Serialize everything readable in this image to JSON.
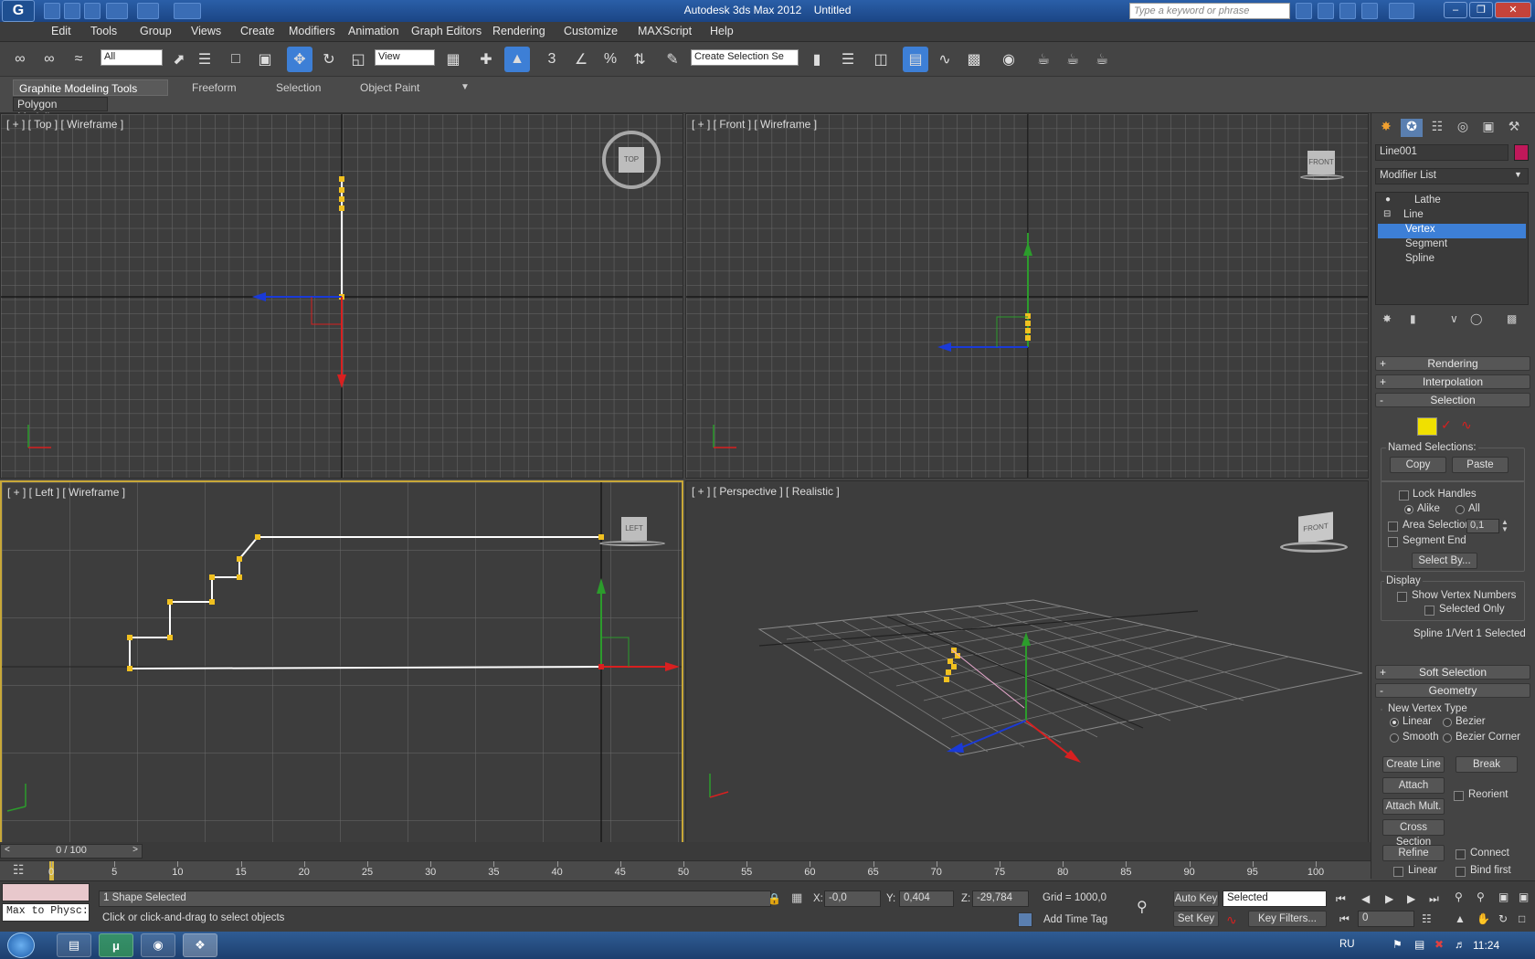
{
  "titlebar": {
    "app_title": "Autodesk 3ds Max  2012",
    "doc_title": "Untitled",
    "search_placeholder": "Type a keyword or phrase"
  },
  "menu": [
    "Edit",
    "Tools",
    "Group",
    "Views",
    "Create",
    "Modifiers",
    "Animation",
    "Graph Editors",
    "Rendering",
    "Customize",
    "MAXScript",
    "Help"
  ],
  "toolbar": {
    "filter_select": "All",
    "refcoord_select": "View",
    "named_selection_select": "Create Selection Se",
    "snap_labels": [
      "3",
      "%"
    ]
  },
  "ribbon": {
    "tabs": [
      "Graphite Modeling Tools",
      "Freeform",
      "Selection",
      "Object Paint"
    ],
    "subpanel": "Polygon Modeling"
  },
  "viewports": {
    "top": "[ + ] [ Top ] [ Wireframe ]",
    "front": "[ + ] [ Front ] [ Wireframe ]",
    "left": "[ + ] [ Left ] [ Wireframe ]",
    "perspective": "[ + ] [ Perspective ] [ Realistic ]",
    "cube_top": "TOP",
    "cube_front": "FRONT",
    "cube_left": "LEFT",
    "cube_persp": "FRONT"
  },
  "command_panel": {
    "object_name": "Line001",
    "object_color": "#c0185a",
    "modifier_list": "Modifier List",
    "stack": [
      "Lathe",
      "Line",
      "Vertex",
      "Segment",
      "Spline"
    ],
    "stack_selected": "Vertex",
    "rollouts": {
      "rendering": "Rendering",
      "interpolation": "Interpolation",
      "selection": "Selection",
      "soft_selection": "Soft Selection",
      "geometry": "Geometry"
    },
    "selection": {
      "named_selections": "Named Selections:",
      "copy": "Copy",
      "paste": "Paste",
      "lock_handles": "Lock Handles",
      "alike": "Alike",
      "all": "All",
      "area_selection": "Area Selection:",
      "area_value": "0,1",
      "segment_end": "Segment End",
      "select_by": "Select By...",
      "display": "Display",
      "show_vertex_numbers": "Show Vertex Numbers",
      "selected_only": "Selected Only",
      "status": "Spline 1/Vert 1 Selected"
    },
    "geometry": {
      "new_vertex_type": "New Vertex Type",
      "linear": "Linear",
      "bezier": "Bezier",
      "smooth": "Smooth",
      "bezier_corner": "Bezier Corner",
      "create_line": "Create Line",
      "break": "Break",
      "attach": "Attach",
      "reorient": "Reorient",
      "attach_mult": "Attach Mult.",
      "cross_section": "Cross Section",
      "refine": "Refine",
      "connect": "Connect",
      "linear2": "Linear",
      "bind_first": "Bind first"
    }
  },
  "timeline": {
    "frame_counter": "0 / 100",
    "ticks": [
      "0",
      "5",
      "10",
      "15",
      "20",
      "25",
      "30",
      "35",
      "40",
      "45",
      "50",
      "55",
      "60",
      "65",
      "70",
      "75",
      "80",
      "85",
      "90",
      "95",
      "100"
    ]
  },
  "status": {
    "maxscript_listener": "Max to Physc:",
    "selection_info": "1 Shape Selected",
    "prompt": "Click or click-and-drag to select objects",
    "x_label": "X:",
    "x_value": "-0,0",
    "y_label": "Y:",
    "y_value": "0,404",
    "z_label": "Z:",
    "z_value": "-29,784",
    "grid": "Grid = 1000,0",
    "auto_key": "Auto Key",
    "set_key": "Set Key",
    "key_mode_select": "Selected",
    "key_filters": "Key Filters...",
    "add_time_tag": "Add Time Tag",
    "current_frame": "0"
  },
  "taskbar": {
    "language": "RU",
    "clock": "11:24"
  }
}
